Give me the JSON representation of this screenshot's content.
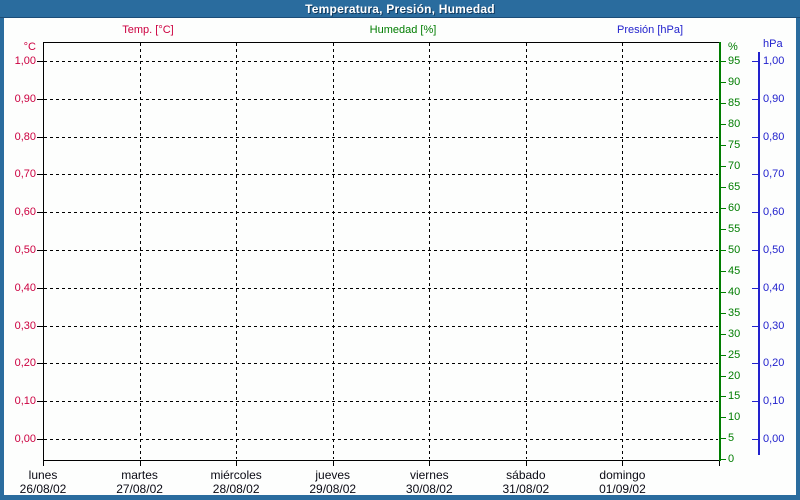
{
  "window": {
    "title": "Temperatura, Presión, Humedad"
  },
  "legend": {
    "items": [
      {
        "label": "Temp. [°C]",
        "color": "#cc0040"
      },
      {
        "label": "Humedad [%]",
        "color": "#007d00"
      },
      {
        "label": "Presión [hPa]",
        "color": "#2222cd"
      }
    ]
  },
  "chart_data": {
    "type": "line",
    "title": "Temperatura, Presión, Humedad",
    "grid": true,
    "legend_position": "top",
    "plot_empty": true,
    "y_axes": [
      {
        "unit": "°C",
        "side": "left",
        "color": "#cc0040",
        "tick_labels": [
          "1,00",
          "0,90",
          "0,80",
          "0,70",
          "0,60",
          "0,50",
          "0,40",
          "0,30",
          "0,20",
          "0,10",
          "0,00"
        ],
        "range": [
          0,
          1.0
        ]
      },
      {
        "unit": "%",
        "side": "right",
        "color": "#007d00",
        "tick_labels": [
          "95",
          "90",
          "85",
          "80",
          "75",
          "70",
          "65",
          "60",
          "55",
          "50",
          "45",
          "40",
          "35",
          "30",
          "25",
          "20",
          "15",
          "10",
          "5",
          "0"
        ],
        "range": [
          0,
          100
        ]
      },
      {
        "unit": "hPa",
        "side": "far-right",
        "color": "#2222cd",
        "tick_labels": [
          "1,00",
          "0,90",
          "0,80",
          "0,70",
          "0,60",
          "0,50",
          "0,40",
          "0,30",
          "0,20",
          "0,10",
          "0,00"
        ],
        "range": [
          0,
          1.0
        ]
      }
    ],
    "x_axis": {
      "ticks": [
        {
          "day": "lunes",
          "date": "26/08/02"
        },
        {
          "day": "martes",
          "date": "27/08/02"
        },
        {
          "day": "miércoles",
          "date": "28/08/02"
        },
        {
          "day": "jueves",
          "date": "29/08/02"
        },
        {
          "day": "viernes",
          "date": "30/08/02"
        },
        {
          "day": "sábado",
          "date": "31/08/02"
        },
        {
          "day": "domingo",
          "date": "01/09/02"
        }
      ]
    },
    "series": [
      {
        "name": "Temp. [°C]",
        "color": "#cc0040",
        "axis": "°C",
        "values": []
      },
      {
        "name": "Humedad [%]",
        "color": "#007d00",
        "axis": "%",
        "values": []
      },
      {
        "name": "Presión [hPa]",
        "color": "#2222cd",
        "axis": "hPa",
        "values": []
      }
    ]
  }
}
